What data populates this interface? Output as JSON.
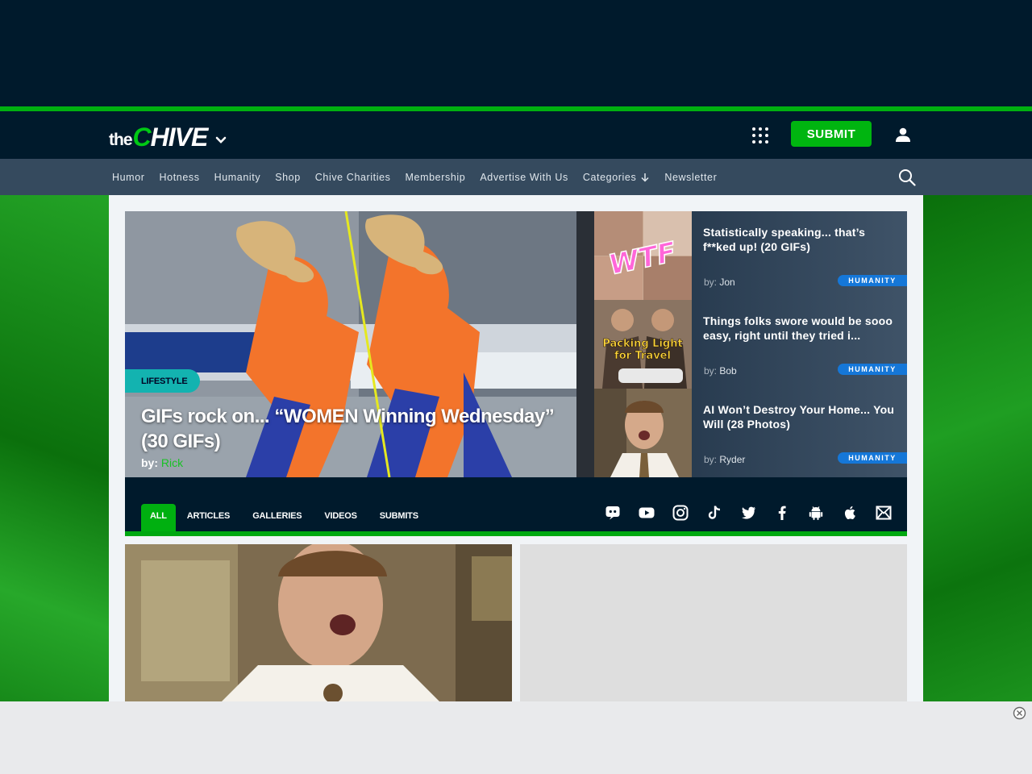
{
  "brand": {
    "logo_prefix": "the",
    "logo_c": "C",
    "logo_rest": "HIVE"
  },
  "header": {
    "submit_label": "SUBMIT"
  },
  "nav": {
    "items": [
      "Humor",
      "Hotness",
      "Humanity",
      "Shop",
      "Chive Charities",
      "Membership",
      "Advertise With Us",
      "Categories",
      "Newsletter"
    ]
  },
  "hero": {
    "category": "LIFESTYLE",
    "title": "GIFs rock on... “WOMEN Winning Wednesday” (30 GIFs)",
    "by_label": "by:",
    "author": "Rick"
  },
  "side_cards": [
    {
      "title": "Statistically speaking... that’s f**ked up! (20 GIFs)",
      "by_label": "by:",
      "author": "Jon",
      "category": "HUMANITY",
      "thumb_text": "WTF"
    },
    {
      "title": "Things folks swore would be sooo easy, right until they tried i...",
      "by_label": "by:",
      "author": "Bob",
      "category": "HUMANITY",
      "thumb_text": "Packing Light for Travel"
    },
    {
      "title": "AI Won’t Destroy Your Home... You Will (28 Photos)",
      "by_label": "by:",
      "author": "Ryder",
      "category": "HUMANITY",
      "thumb_text": ""
    }
  ],
  "tabs": [
    "ALL",
    "ARTICLES",
    "GALLERIES",
    "VIDEOS",
    "SUBMITS"
  ],
  "active_tab": "ALL",
  "socials": [
    "discord-icon",
    "youtube-icon",
    "instagram-icon",
    "tiktok-icon",
    "twitter-icon",
    "facebook-icon",
    "android-icon",
    "apple-icon",
    "email-icon"
  ],
  "colors": {
    "navy": "#001a2c",
    "green": "#00b010",
    "subnav": "#354a5e",
    "teal_badge": "#13b3b0",
    "blue_badge": "#1577d8"
  }
}
